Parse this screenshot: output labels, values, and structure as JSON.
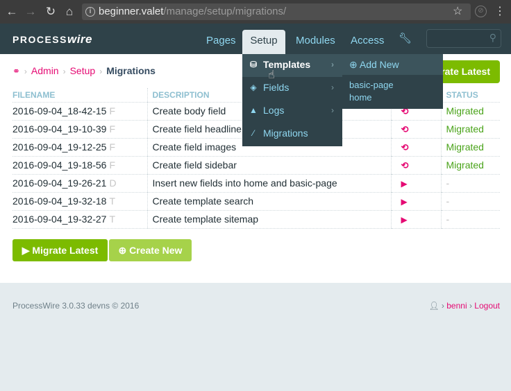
{
  "browser": {
    "url_host": "beginner.valet",
    "url_path": "/manage/setup/migrations/",
    "icons": [
      "back-arrow",
      "forward-arrow",
      "reload",
      "home",
      "info",
      "star",
      "extension",
      "kebab-menu"
    ]
  },
  "topnav": {
    "logo_main": "PROCESS",
    "logo_accent": "wire",
    "items": [
      {
        "label": "Pages"
      },
      {
        "label": "Setup"
      },
      {
        "label": "Modules"
      },
      {
        "label": "Access"
      }
    ],
    "search_placeholder": ""
  },
  "setup_menu": {
    "items": [
      {
        "label": "Templates",
        "icon": "templates-icon"
      },
      {
        "label": "Fields",
        "icon": "cube-icon"
      },
      {
        "label": "Logs",
        "icon": "tree-icon"
      },
      {
        "label": "Migrations",
        "icon": "magic-wand-icon"
      }
    ]
  },
  "templates_submenu": {
    "add_new": "Add New",
    "items": [
      "basic-page",
      "home"
    ]
  },
  "breadcrumb": {
    "items": [
      "Admin",
      "Setup"
    ],
    "current": "Migrations"
  },
  "top_button": "rate Latest",
  "table": {
    "headers": [
      "FILENAME",
      "DESCRIPTION",
      "STATUS"
    ],
    "rows": [
      {
        "filename": "2016-09-04_18-42-15",
        "type": "F",
        "description": "Create body field",
        "status": "Migrated"
      },
      {
        "filename": "2016-09-04_19-10-39",
        "type": "F",
        "description": "Create field headline",
        "status": "Migrated"
      },
      {
        "filename": "2016-09-04_19-12-25",
        "type": "F",
        "description": "Create field images",
        "status": "Migrated"
      },
      {
        "filename": "2016-09-04_19-18-56",
        "type": "F",
        "description": "Create field sidebar",
        "status": "Migrated"
      },
      {
        "filename": "2016-09-04_19-26-21",
        "type": "D",
        "description": "Insert new fields into home and basic-page",
        "status": "-"
      },
      {
        "filename": "2016-09-04_19-32-18",
        "type": "T",
        "description": "Create template search",
        "status": "-"
      },
      {
        "filename": "2016-09-04_19-32-27",
        "type": "T",
        "description": "Create template sitemap",
        "status": "-"
      }
    ]
  },
  "buttons": {
    "migrate_latest": "Migrate Latest",
    "create_new": "Create New"
  },
  "footer": {
    "version": "ProcessWire 3.0.33 devns © 2016",
    "user": "benni",
    "logout": "Logout"
  },
  "colors": {
    "nav_bg": "#2f4249",
    "accent_pink": "#e50a73",
    "green": "#7cbb00",
    "light_blue": "#8fd7f0"
  }
}
